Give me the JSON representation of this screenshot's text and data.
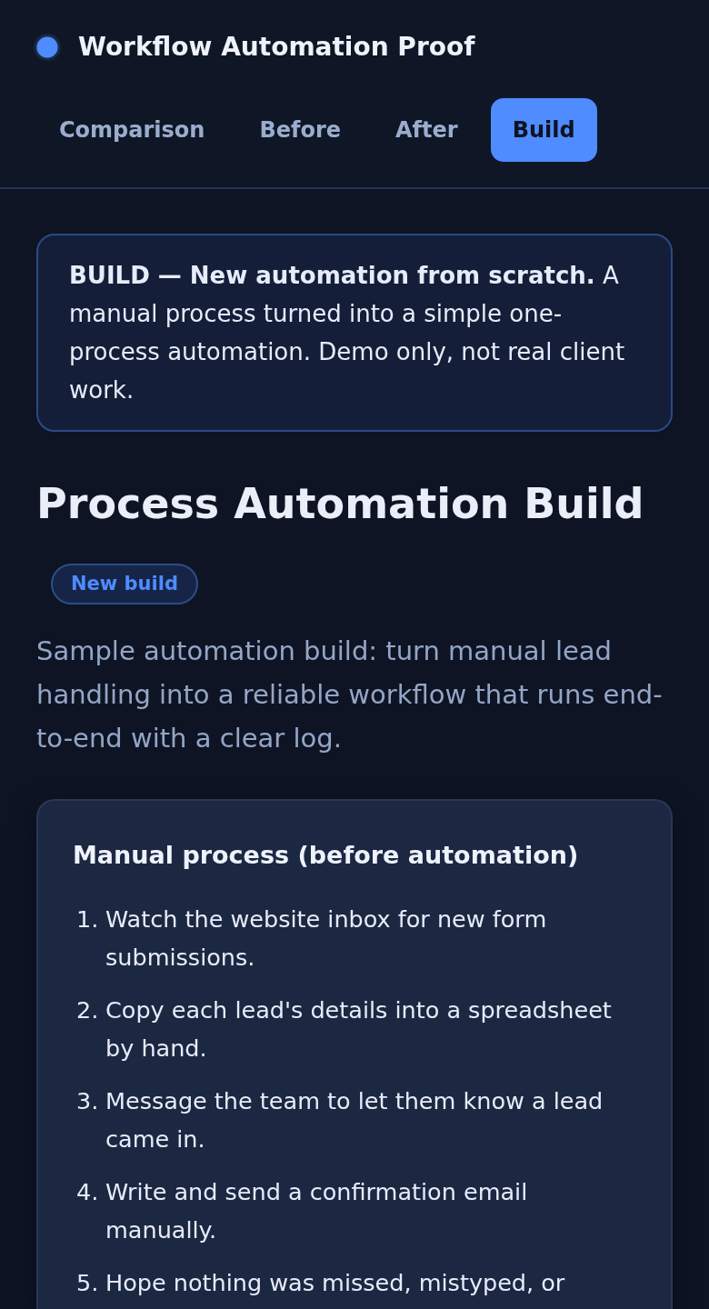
{
  "header": {
    "title": "Workflow Automation Proof"
  },
  "tabs": [
    {
      "label": "Comparison",
      "selected": false
    },
    {
      "label": "Before",
      "selected": false
    },
    {
      "label": "After",
      "selected": false
    },
    {
      "label": "Build",
      "selected": true
    }
  ],
  "notice": {
    "text": "**BUILD — New automation from scratch.** A manual process turned into a simple one-process automation. Demo only, not real client work."
  },
  "intro": {
    "heading": "Process Automation Build",
    "badge": "New build",
    "description": "Sample automation build: turn manual lead handling into a reliable workflow that runs end-to-end with a clear log."
  },
  "card": {
    "title": "Manual process (before automation)",
    "steps": [
      {
        "number": "1.",
        "text": "Watch the website inbox for new form submissions."
      },
      {
        "number": "2.",
        "text": "Copy each lead's details into a spreadsheet by hand."
      },
      {
        "number": "3.",
        "text": "Message the team to let them know a lead came in."
      },
      {
        "number": "4.",
        "text": "Write and send a confirmation email manually."
      },
      {
        "number": "5.",
        "text": "Hope nothing was missed, mistyped, or"
      }
    ]
  }
}
